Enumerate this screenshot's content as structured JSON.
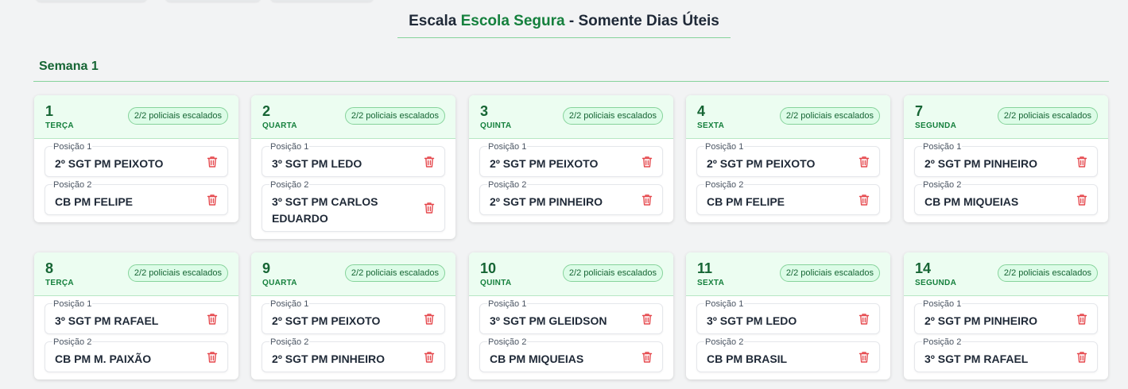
{
  "page": {
    "title_prefix": "Escala ",
    "title_accent": "Escola Segura",
    "title_suffix": " - Somente Dias Úteis"
  },
  "weeks": [
    {
      "label": "Semana 1",
      "days": [
        {
          "num": "1",
          "name": "TERÇA",
          "badge": "2/2 policiais escalados",
          "slots": [
            {
              "label": "Posição 1",
              "value": "2º SGT PM PEIXOTO"
            },
            {
              "label": "Posição 2",
              "value": "CB PM FELIPE"
            }
          ]
        },
        {
          "num": "2",
          "name": "QUARTA",
          "badge": "2/2 policiais escalados",
          "slots": [
            {
              "label": "Posição 1",
              "value": "3º SGT PM LEDO"
            },
            {
              "label": "Posição 2",
              "value": "3º SGT PM CARLOS EDUARDO"
            }
          ]
        },
        {
          "num": "3",
          "name": "QUINTA",
          "badge": "2/2 policiais escalados",
          "slots": [
            {
              "label": "Posição 1",
              "value": "2º SGT PM PEIXOTO"
            },
            {
              "label": "Posição 2",
              "value": "2º SGT PM PINHEIRO"
            }
          ]
        },
        {
          "num": "4",
          "name": "SEXTA",
          "badge": "2/2 policiais escalados",
          "slots": [
            {
              "label": "Posição 1",
              "value": "2º SGT PM PEIXOTO"
            },
            {
              "label": "Posição 2",
              "value": "CB PM FELIPE"
            }
          ]
        },
        {
          "num": "7",
          "name": "SEGUNDA",
          "badge": "2/2 policiais escalados",
          "slots": [
            {
              "label": "Posição 1",
              "value": "2º SGT PM PINHEIRO"
            },
            {
              "label": "Posição 2",
              "value": "CB PM MIQUEIAS"
            }
          ]
        },
        {
          "num": "8",
          "name": "TERÇA",
          "badge": "2/2 policiais escalados",
          "slots": [
            {
              "label": "Posição 1",
              "value": "3º SGT PM RAFAEL"
            },
            {
              "label": "Posição 2",
              "value": "CB PM M. PAIXÃO"
            }
          ]
        },
        {
          "num": "9",
          "name": "QUARTA",
          "badge": "2/2 policiais escalados",
          "slots": [
            {
              "label": "Posição 1",
              "value": "2º SGT PM PEIXOTO"
            },
            {
              "label": "Posição 2",
              "value": "2º SGT PM PINHEIRO"
            }
          ]
        },
        {
          "num": "10",
          "name": "QUINTA",
          "badge": "2/2 policiais escalados",
          "slots": [
            {
              "label": "Posição 1",
              "value": "3º SGT PM GLEIDSON"
            },
            {
              "label": "Posição 2",
              "value": "CB PM MIQUEIAS"
            }
          ]
        },
        {
          "num": "11",
          "name": "SEXTA",
          "badge": "2/2 policiais escalados",
          "slots": [
            {
              "label": "Posição 1",
              "value": "3º SGT PM LEDO"
            },
            {
              "label": "Posição 2",
              "value": "CB PM BRASIL"
            }
          ]
        },
        {
          "num": "14",
          "name": "SEGUNDA",
          "badge": "2/2 policiais escalados",
          "slots": [
            {
              "label": "Posição 1",
              "value": "2º SGT PM PINHEIRO"
            },
            {
              "label": "Posição 2",
              "value": "3º SGT PM RAFAEL"
            }
          ]
        }
      ]
    }
  ],
  "icons": {
    "remove": "trash-icon"
  },
  "colors": {
    "accent": "#15803d",
    "header_bg": "#ecfdf1",
    "danger": "#e5484d"
  }
}
